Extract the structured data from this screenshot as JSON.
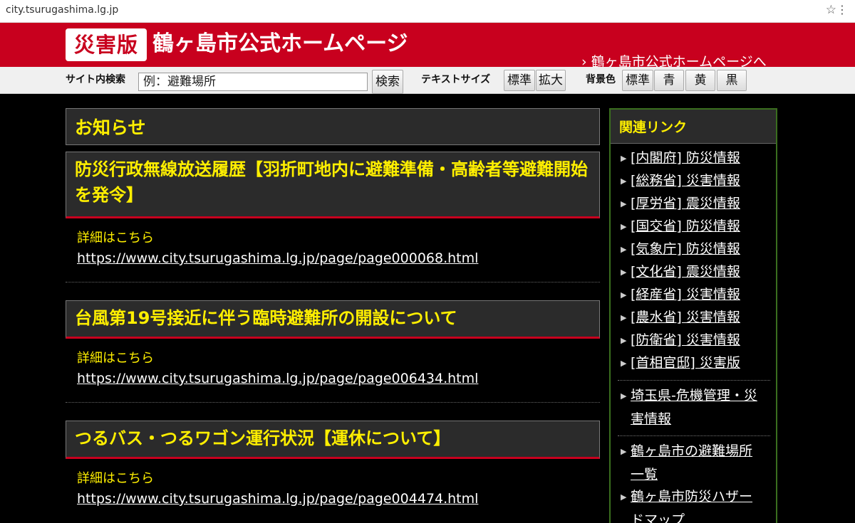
{
  "browser": {
    "url": "city.tsurugashima.lg.jp"
  },
  "header": {
    "badge": "災害版",
    "title": "鶴ヶ島市公式ホームページ",
    "home_link": "鶴ヶ島市公式ホームページへ",
    "bg_color": "#c8001e"
  },
  "toolbar": {
    "search_label": "サイト内検索",
    "search_placeholder": "例：避難場所",
    "search_button": "検索",
    "text_size_label": "テキストサイズ",
    "size_standard": "標準",
    "size_large": "拡大",
    "bg_label": "背景色",
    "bg_standard": "標準",
    "bg_blue": "青",
    "bg_yellow": "黄",
    "bg_black": "黒"
  },
  "main": {
    "section_title": "お知らせ",
    "articles": [
      {
        "title": "防災行政無線放送履歴【羽折町地内に避難準備・高齢者等避難開始を発令】",
        "detail_label": "詳細はこちら",
        "url": "https://www.city.tsurugashima.lg.jp/page/page000068.html"
      },
      {
        "title": "台風第19号接近に伴う臨時避難所の開設について",
        "detail_label": "詳細はこちら",
        "url": "https://www.city.tsurugashima.lg.jp/page/page006434.html"
      },
      {
        "title": "つるバス・つるワゴン運行状況【運休について】",
        "detail_label": "詳細はこちら",
        "url": "https://www.city.tsurugashima.lg.jp/page/page004474.html"
      }
    ]
  },
  "sidebar": {
    "title": "関連リンク",
    "links": [
      "[内閣府] 防災情報",
      "[総務省] 災害情報",
      "[厚労省] 震災情報",
      "[国交省] 防災情報",
      "[気象庁] 防災情報",
      "[文化省] 震災情報",
      "[経産省] 災害情報",
      "[農水省] 災害情報",
      "[防衛省] 災害情報",
      "[首相官邸] 災害版"
    ],
    "pref_link_line1": "埼玉県-危機管理・災",
    "pref_link_line2": "害情報",
    "shelter_line1": "鶴ヶ島市の避難場所",
    "shelter_line2": "一覧",
    "hazard_line1": "鶴ヶ島市防災ハザー",
    "hazard_line2": "ドマップ"
  }
}
